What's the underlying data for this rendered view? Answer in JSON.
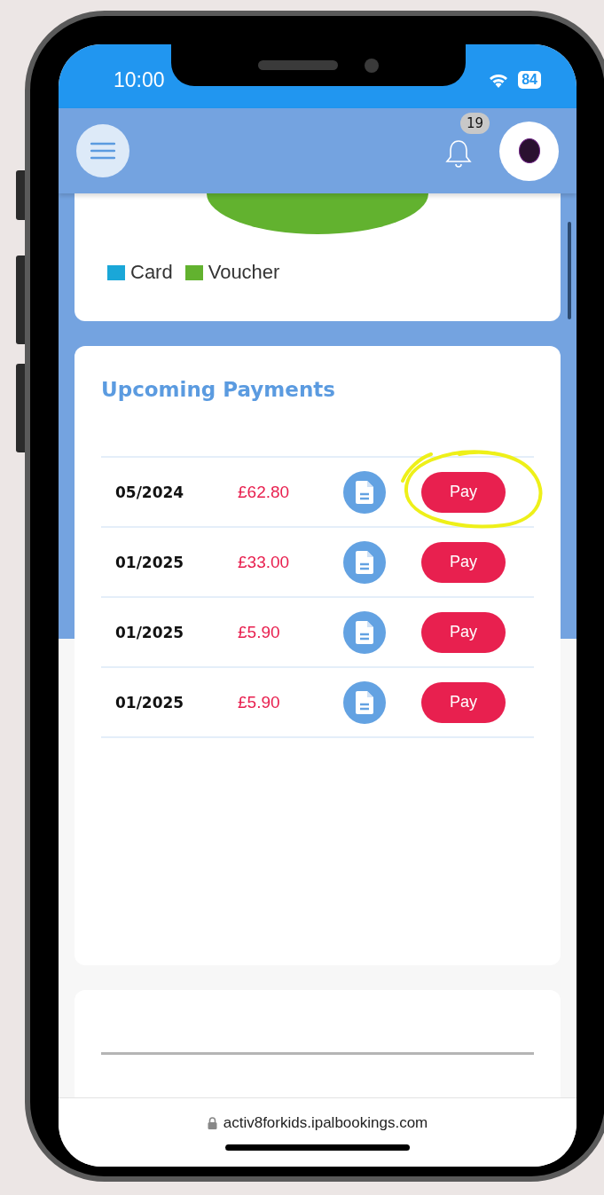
{
  "status_bar": {
    "time": "10:00",
    "battery": "84"
  },
  "header": {
    "notification_count": "19"
  },
  "chart_legend": [
    {
      "label": "Card",
      "color": "#1aa7d8"
    },
    {
      "label": "Voucher",
      "color": "#62b22f"
    }
  ],
  "upcoming_payments": {
    "title": "Upcoming Payments",
    "rows": [
      {
        "date": "05/2024",
        "amount": "£62.80",
        "button": "Pay",
        "highlighted": true
      },
      {
        "date": "01/2025",
        "amount": "£33.00",
        "button": "Pay",
        "highlighted": false
      },
      {
        "date": "01/2025",
        "amount": "£5.90",
        "button": "Pay",
        "highlighted": false
      },
      {
        "date": "01/2025",
        "amount": "£5.90",
        "button": "Pay",
        "highlighted": false
      }
    ]
  },
  "browser": {
    "url": "activ8forkids.ipalbookings.com"
  }
}
